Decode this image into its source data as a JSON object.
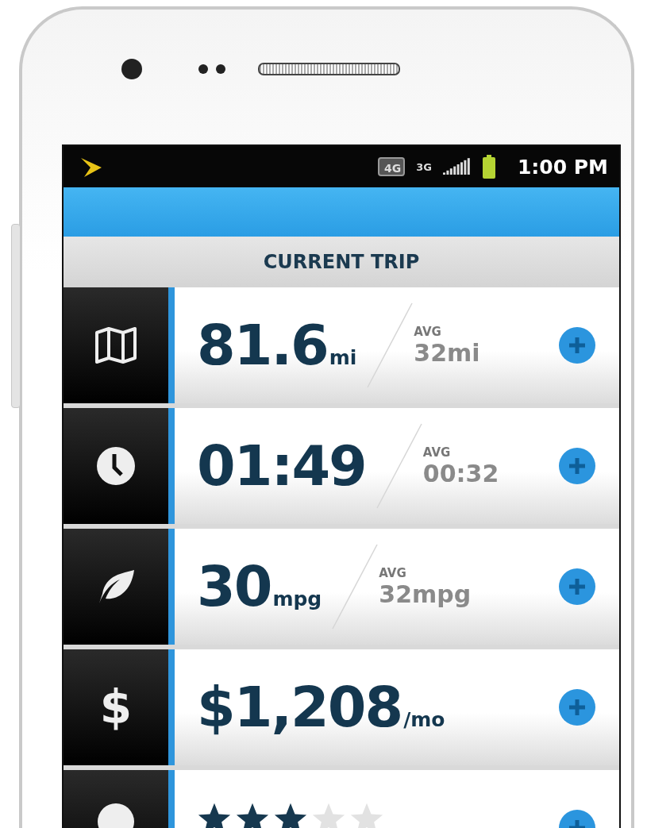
{
  "status_bar": {
    "network_4g": "4G",
    "network_3g": "3G",
    "time": "1:00 PM"
  },
  "header": {
    "title": "CURRENT TRIP"
  },
  "rows": [
    {
      "kind": "metric",
      "value": "81.6",
      "unit": "mi",
      "avg_label": "AVG",
      "avg_value": "32mi"
    },
    {
      "kind": "metric",
      "value": "01:49",
      "avg_label": "AVG",
      "avg_value": "00:32"
    },
    {
      "kind": "metric",
      "value": "30",
      "unit": "mpg",
      "avg_label": "AVG",
      "avg_value": "32mpg"
    },
    {
      "kind": "metric",
      "glyph": "$",
      "value": "$1,208",
      "unit": "/mo"
    },
    {
      "kind": "rating",
      "stars": 3
    }
  ]
}
